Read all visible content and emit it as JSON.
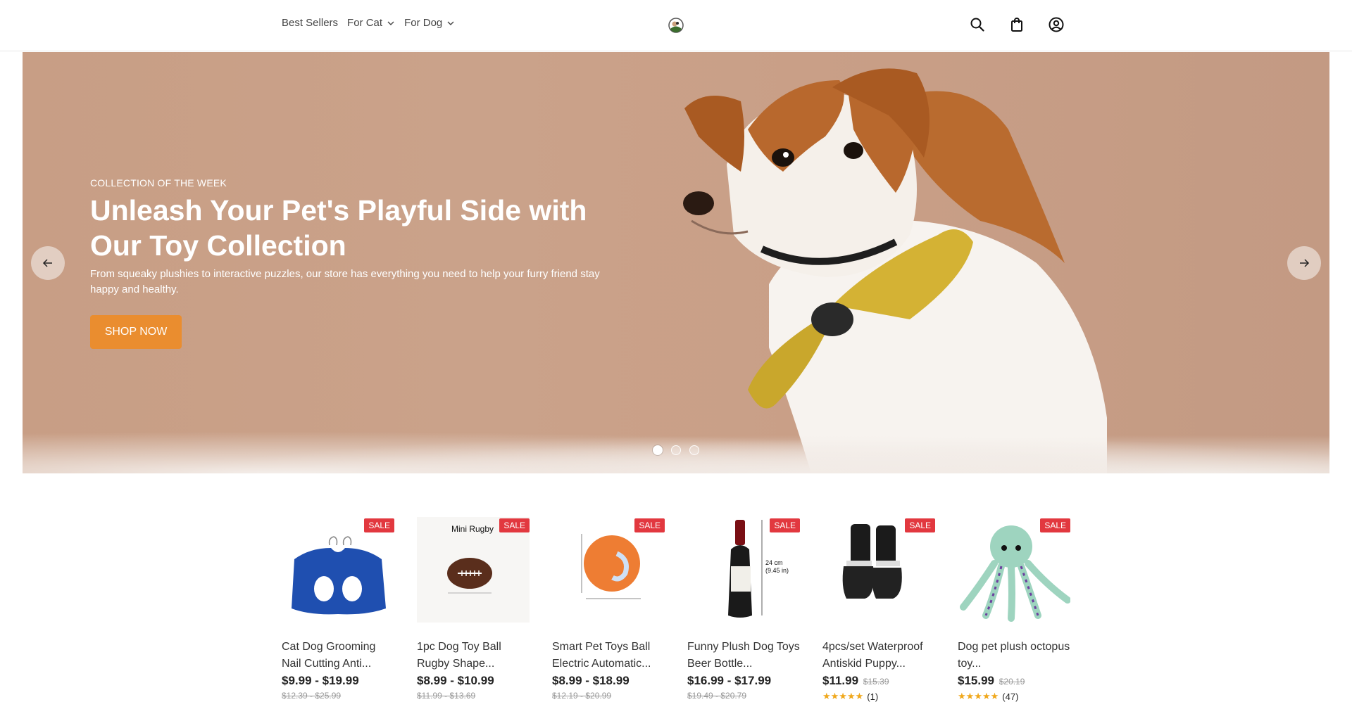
{
  "nav": {
    "items": [
      {
        "label": "Best Sellers",
        "dropdown": false
      },
      {
        "label": "For Cat",
        "dropdown": true
      },
      {
        "label": "For Dog",
        "dropdown": true
      }
    ]
  },
  "header": {
    "icons": [
      "search-icon",
      "shopping-bag-icon",
      "account-icon"
    ]
  },
  "hero": {
    "eyebrow": "COLLECTION OF THE WEEK",
    "title": "Unleash Your Pet's Playful Side with Our Toy Collection",
    "description": "From squeaky plushies to interactive puzzles, our store has everything you need to help your furry friend stay happy and healthy.",
    "button_label": "SHOP NOW",
    "slides": 3,
    "active_slide": 1
  },
  "products": [
    {
      "name": "Cat Dog Grooming Nail Cutting Anti...",
      "badge": "SALE",
      "price": "$9.99 - $19.99",
      "old_price": "$12.39 - $25.99"
    },
    {
      "name": "1pc Dog Toy Ball Rugby Shape...",
      "badge": "SALE",
      "price": "$8.99 - $10.99",
      "old_price": "$11.99 - $13.69",
      "image_text": "Mini Rugby"
    },
    {
      "name": "Smart Pet Toys Ball Electric Automatic...",
      "badge": "SALE",
      "price": "$8.99 - $18.99",
      "old_price": "$12.19 - $20.99"
    },
    {
      "name": "Funny Plush Dog Toys Beer Bottle...",
      "badge": "SALE",
      "price": "$16.99 - $17.99",
      "old_price": "$19.49 - $20.79",
      "image_text": "24 cm (9.45 in)"
    },
    {
      "name": "4pcs/set Waterproof Antiskid Puppy...",
      "badge": "SALE",
      "price": "$11.99",
      "old_price": "$15.39",
      "rating_count": "(1)"
    },
    {
      "name": "Dog pet plush octopus toy...",
      "badge": "SALE",
      "price": "$15.99",
      "old_price": "$20.19",
      "rating_count": "(47)"
    }
  ],
  "colors": {
    "accent": "#ea8d2f",
    "sale": "#e2383f",
    "hero_bg": "#c89e85"
  }
}
